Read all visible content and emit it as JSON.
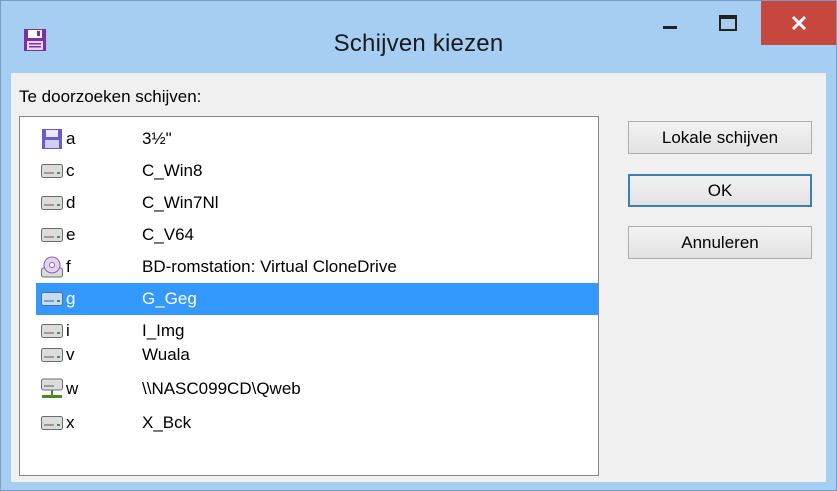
{
  "window": {
    "title": "Schijven kiezen"
  },
  "label": "Te doorzoeken schijven:",
  "drives": [
    {
      "letter": "a",
      "name": "3½\"",
      "icon": "floppy-icon"
    },
    {
      "letter": "c",
      "name": "C_Win8",
      "icon": "hard-drive-icon"
    },
    {
      "letter": "d",
      "name": "C_Win7Nl",
      "icon": "hard-drive-icon"
    },
    {
      "letter": "e",
      "name": "C_V64",
      "icon": "hard-drive-icon"
    },
    {
      "letter": "f",
      "name": "BD-romstation: Virtual CloneDrive",
      "icon": "optical-drive-icon"
    },
    {
      "letter": "g",
      "name": "G_Geg",
      "icon": "hard-drive-icon",
      "selected": true
    },
    {
      "letter": "i",
      "name": "I_Img",
      "icon": "hard-drive-icon"
    },
    {
      "letter": "v",
      "name": "Wuala",
      "icon": "hard-drive-icon"
    },
    {
      "letter": "w",
      "name": "\\\\NASC099CD\\Qweb",
      "icon": "network-drive-icon"
    },
    {
      "letter": "x",
      "name": "X_Bck",
      "icon": "hard-drive-icon"
    }
  ],
  "buttons": {
    "local": "Lokale schijven",
    "ok": "OK",
    "cancel": "Annuleren"
  },
  "colors": {
    "selection": "#3399ff",
    "close": "#c7463e",
    "frame": "#a6cdf2"
  }
}
